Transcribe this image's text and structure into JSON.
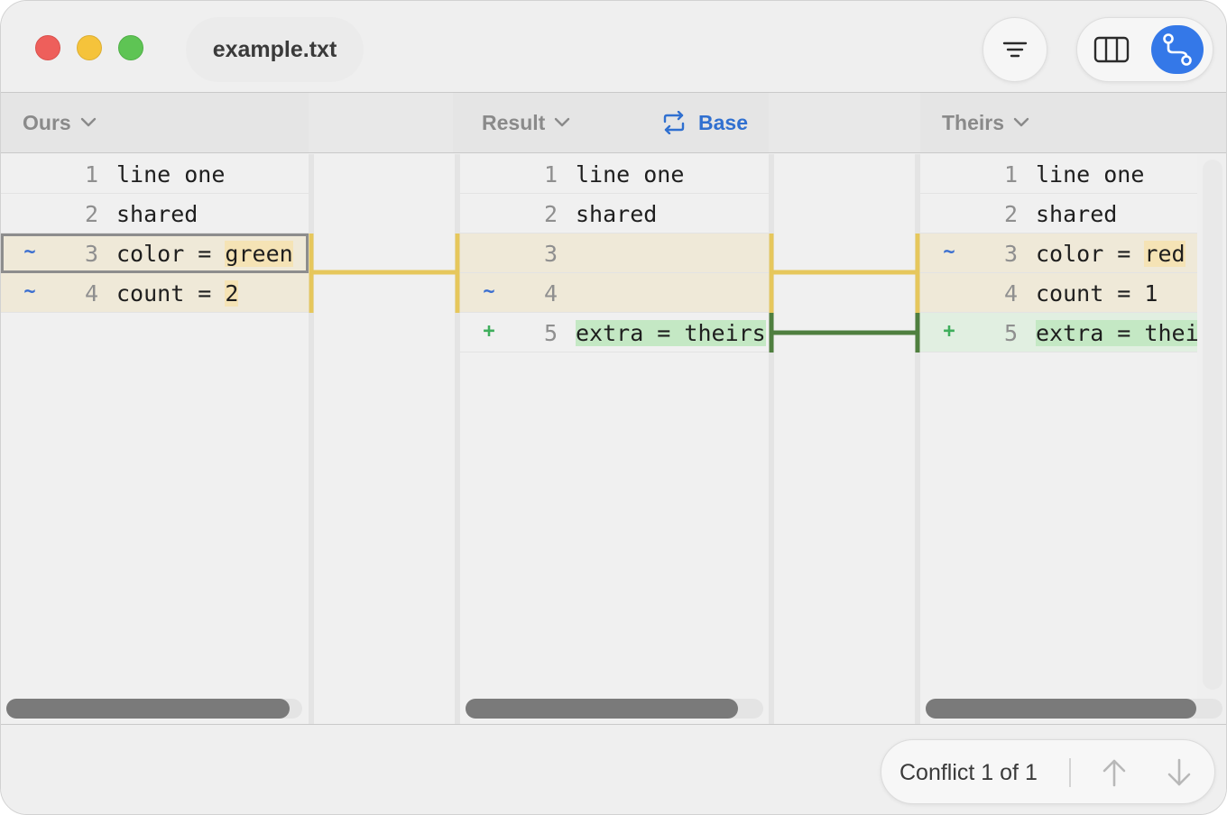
{
  "window": {
    "filename": "example.txt"
  },
  "headers": {
    "ours": "Ours",
    "result": "Result",
    "base": "Base",
    "theirs": "Theirs"
  },
  "ours": {
    "lines": [
      {
        "num": "1",
        "marker": "",
        "code": "line one"
      },
      {
        "num": "2",
        "marker": "",
        "code": "shared"
      },
      {
        "num": "3",
        "marker": "~",
        "code_prefix": "color = ",
        "code_hl": "green"
      },
      {
        "num": "4",
        "marker": "~",
        "code_prefix": "count = ",
        "code_hl": "2"
      }
    ]
  },
  "result": {
    "lines": [
      {
        "num": "1",
        "marker": "",
        "code": "line one"
      },
      {
        "num": "2",
        "marker": "",
        "code": "shared"
      },
      {
        "num": "3",
        "marker": "",
        "code": ""
      },
      {
        "num": "4",
        "marker": "~",
        "code": ""
      },
      {
        "num": "5",
        "marker": "+",
        "code_hl": "extra = theirs"
      }
    ]
  },
  "theirs": {
    "lines": [
      {
        "num": "1",
        "marker": "",
        "code": "line one"
      },
      {
        "num": "2",
        "marker": "",
        "code": "shared"
      },
      {
        "num": "3",
        "marker": "~",
        "code_prefix": "color = ",
        "code_hl": "red"
      },
      {
        "num": "4",
        "marker": "",
        "code": "count = 1"
      },
      {
        "num": "5",
        "marker": "+",
        "code_hl": "extra = theirs"
      }
    ]
  },
  "footer": {
    "conflict_label": "Conflict 1 of 1"
  },
  "colors": {
    "modified_bg": "#efe9d8",
    "added_bg": "#e1efe1",
    "modified_connector": "#e6c75c",
    "added_connector": "#4f7f3f",
    "accent": "#3478e8"
  },
  "icons": [
    "filter-icon",
    "columns-icon",
    "merge-icon",
    "chevron-down-icon",
    "swap-icon",
    "arrow-up-icon",
    "arrow-down-icon"
  ]
}
